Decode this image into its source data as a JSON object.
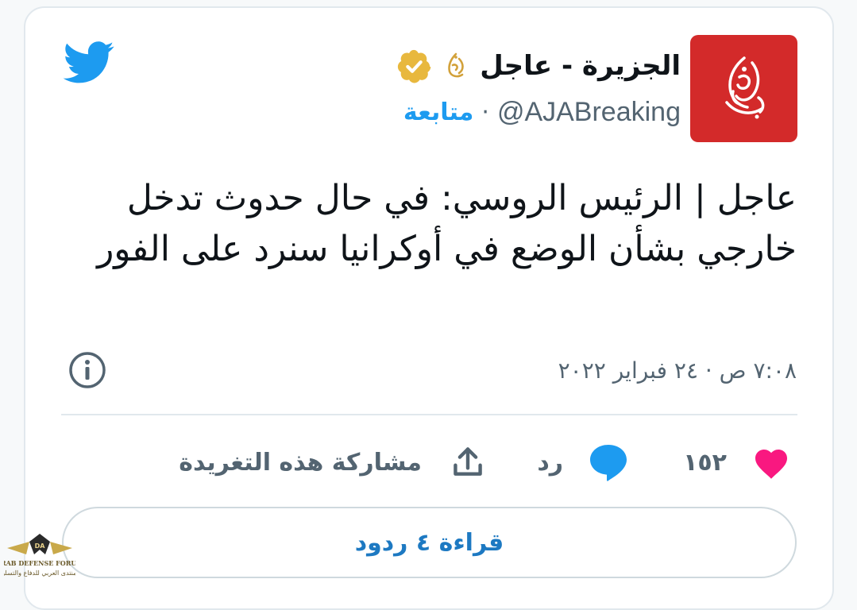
{
  "account": {
    "name": "الجزيرة - عاجل",
    "handle": "@AJABreaking",
    "separator": "·",
    "follow_label": "متابعة",
    "verified_color": "#e8b83e",
    "logo_color": "#d32a2a"
  },
  "tweet": {
    "text": "عاجل | الرئيس الروسي: في حال حدوث تدخل خارجي بشأن الوضع في أوكرانيا سنرد على الفور",
    "timestamp": "٧:٠٨ ص · ٢٤ فبراير ٢٠٢٢"
  },
  "actions": {
    "like_count": "١٥٢",
    "reply_label": "رد",
    "share_label": "مشاركة هذه التغريدة"
  },
  "replies_button": {
    "label": "قراءة ٤ ردود"
  },
  "watermark": {
    "line1": "ARAB DEFENSE FORUM",
    "line2": "المنتدى العربي للدفاع والتسليح"
  },
  "colors": {
    "twitter_blue": "#1d9bf0",
    "like_pink": "#f91880",
    "text_primary": "#0f1419",
    "text_secondary": "#536471"
  }
}
